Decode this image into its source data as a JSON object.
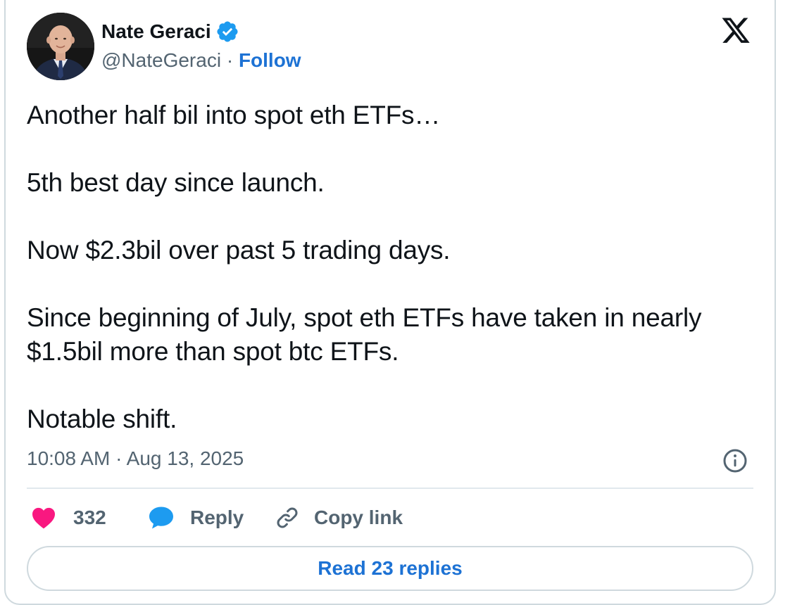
{
  "author": {
    "name": "Nate Geraci",
    "handle": "@NateGeraci",
    "separator": " · ",
    "follow_label": "Follow",
    "verified": true,
    "avatar_icon": "person-portrait"
  },
  "platform_icon": "x-logo",
  "tweet": {
    "paragraphs": [
      "Another half bil into spot eth ETFs…",
      "5th best day since launch.",
      "Now $2.3bil over past 5 trading days.",
      "Since beginning of July, spot eth ETFs have taken in nearly $1.5bil more than spot btc ETFs.",
      "Notable shift."
    ],
    "timestamp": "10:08 AM · Aug 13, 2025"
  },
  "actions": {
    "likes_count": "332",
    "reply_label": "Reply",
    "copy_link_label": "Copy link"
  },
  "read_replies_label": "Read 23 replies",
  "colors": {
    "link_blue": "#1d72d4",
    "verified_blue": "#1d9bf0",
    "heart_pink": "#f91880",
    "secondary_text": "#536471",
    "border": "#cfd9de"
  }
}
